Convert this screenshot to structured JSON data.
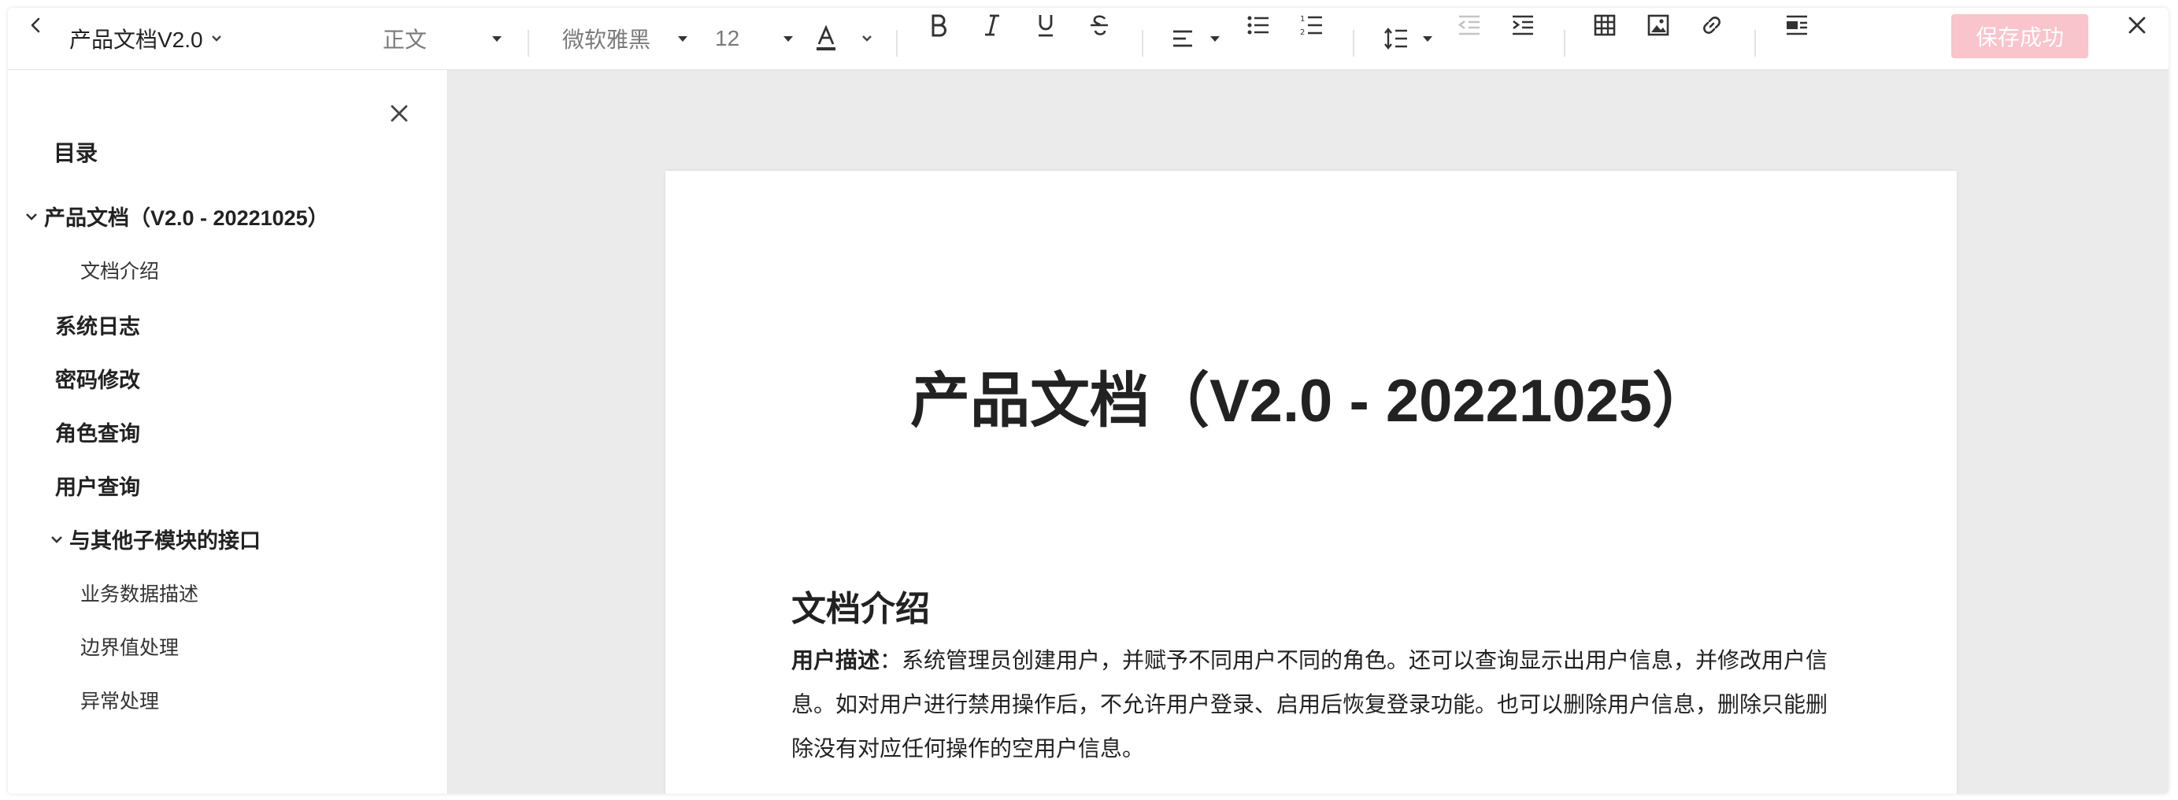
{
  "toolbar": {
    "doc_title": "产品文档V2.0",
    "paragraph_style": "正文",
    "font_family": "微软雅黑",
    "font_size": "12",
    "save_label": "保存成功",
    "save_color": "#f9c4cb"
  },
  "sidebar": {
    "toc_title": "目录",
    "items": [
      {
        "label": "产品文档（V2.0 - 20221025）"
      },
      {
        "label": "文档介绍"
      },
      {
        "label": "系统日志"
      },
      {
        "label": "密码修改"
      },
      {
        "label": "角色查询"
      },
      {
        "label": "用户查询"
      },
      {
        "label": "与其他子模块的接口"
      },
      {
        "label": "业务数据描述"
      },
      {
        "label": "边界值处理"
      },
      {
        "label": "异常处理"
      }
    ]
  },
  "document": {
    "title": "产品文档（V2.0 - 20221025）",
    "section_heading": "文档介绍",
    "para_label": "用户描述",
    "para_text": "：系统管理员创建用户，并赋予不同用户不同的角色。还可以查询显示出用户信息，并修改用户信息。如对用户进行禁用操作后，不允许用户登录、启用后恢复登录功能。也可以删除用户信息，删除只能删除没有对应任何操作的空用户信息。"
  }
}
